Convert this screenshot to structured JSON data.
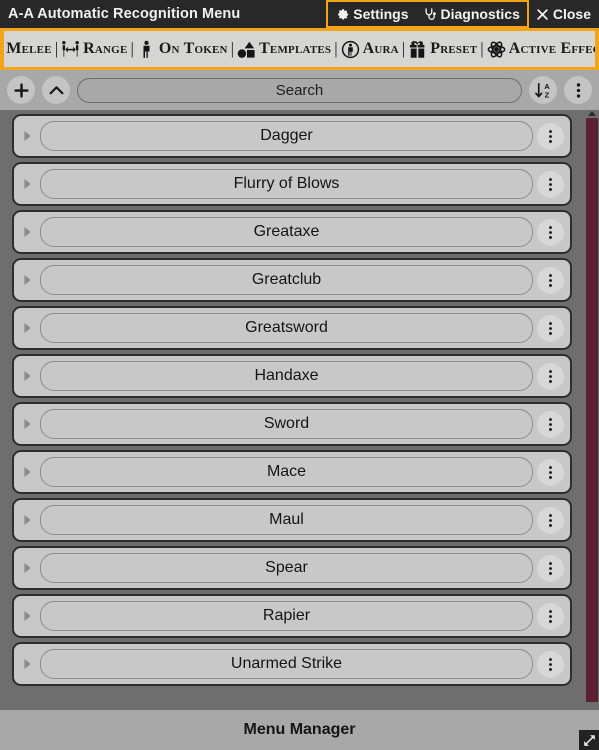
{
  "window": {
    "title": "A-A Automatic Recognition Menu",
    "accent_color": "#f5a417",
    "titlebar_bg": "#282828",
    "scrollbar_thumb_color": "#5c2233"
  },
  "titlebar_buttons": [
    {
      "id": "settings",
      "label": "Settings",
      "icon": "gear-icon",
      "grouped": true
    },
    {
      "id": "diagnostics",
      "label": "Diagnostics",
      "icon": "stethoscope-icon",
      "grouped": true
    },
    {
      "id": "close",
      "label": "Close",
      "icon": "close-x-icon",
      "grouped": false
    }
  ],
  "toolbar": {
    "items": [
      {
        "id": "melee",
        "label": "Melee",
        "icon": "shield-icon"
      },
      {
        "id": "range",
        "label": "Range",
        "icon": "range-people-icon"
      },
      {
        "id": "on-token",
        "label": "On Token",
        "icon": "person-icon"
      },
      {
        "id": "templates",
        "label": "Templates",
        "icon": "shapes-icon"
      },
      {
        "id": "aura",
        "label": "Aura",
        "icon": "aura-person-circle-icon"
      },
      {
        "id": "preset",
        "label": "Preset",
        "icon": "gift-icon"
      },
      {
        "id": "active-effects",
        "label": "Active Effects",
        "icon": "atom-icon"
      }
    ],
    "separator": "|"
  },
  "search_row": {
    "add_label": "+",
    "collapse_label": "Collapse All",
    "search_placeholder": "Search",
    "search_value": "",
    "sort_label": "Sort A-Z",
    "overflow_label": "More Options",
    "icons": {
      "add": "plus-icon",
      "collapse": "chevron-up-icon",
      "sort": "sort-alpha-down-icon",
      "overflow": "vertical-dots-icon"
    }
  },
  "list": {
    "expand_icon": "triangle-right-icon",
    "row_menu_icon": "vertical-dots-icon",
    "items": [
      {
        "name": "Dagger"
      },
      {
        "name": "Flurry of Blows"
      },
      {
        "name": "Greataxe"
      },
      {
        "name": "Greatclub"
      },
      {
        "name": "Greatsword"
      },
      {
        "name": "Handaxe"
      },
      {
        "name": "Sword"
      },
      {
        "name": "Mace"
      },
      {
        "name": "Maul"
      },
      {
        "name": "Spear"
      },
      {
        "name": "Rapier"
      },
      {
        "name": "Unarmed Strike"
      }
    ]
  },
  "footer": {
    "title": "Menu Manager",
    "resize_icon": "resize-diagonal-icon"
  }
}
